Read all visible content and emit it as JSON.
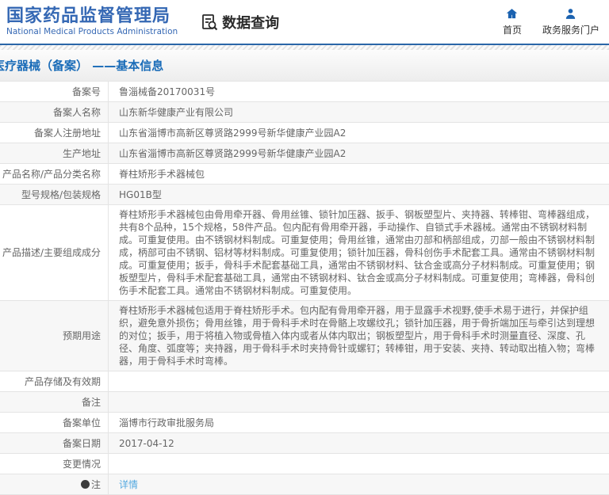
{
  "header": {
    "logo_title": "国家药品监督管理局",
    "logo_subtitle": "National Medical Products Administration",
    "section_title": "数据查询",
    "nav": [
      {
        "label": "首页",
        "icon": "home-icon"
      },
      {
        "label": "政务服务门户",
        "icon": "user-icon"
      }
    ]
  },
  "page": {
    "title": "医疗器械（备案） ——基本信息"
  },
  "table": {
    "rows": [
      {
        "key": "record-number",
        "label": "备案号",
        "value": "鲁淄械备20170031号"
      },
      {
        "key": "filer-name",
        "label": "备案人名称",
        "value": "山东新华健康产业有限公司"
      },
      {
        "key": "filer-registered-address",
        "label": "备案人注册地址",
        "value": "山东省淄博市高新区尊贤路2999号新华健康产业园A2"
      },
      {
        "key": "production-address",
        "label": "生产地址",
        "value": "山东省淄博市高新区尊贤路2999号新华健康产业园A2"
      },
      {
        "key": "product-name",
        "label": "产品名称/产品分类名称",
        "value": "脊柱矫形手术器械包"
      },
      {
        "key": "model-spec",
        "label": "型号规格/包装规格",
        "value": "HG01B型"
      },
      {
        "key": "product-description",
        "label": "产品描述/主要组成成分",
        "value": "脊柱矫形手术器械包由骨用牵开器、骨用丝锥、锁针加压器、扳手、钢板塑型片、夹持器、转棒钳、弯棒器组成，共有8个品种，15个规格，58件产品。包内配有骨用牵开器，手动操作、自锁式手术器械。通常由不锈钢材料制成。可重复使用。由不锈钢材料制成。可重复使用；骨用丝锥，通常由刃部和柄部组成，刃部一般由不锈钢材料制成，柄部可由不锈钢、铝材等材料制成。可重复使用；锁针加压器，骨科创伤手术配套工具。通常由不锈钢材料制成。可重复使用；扳手，骨科手术配套基础工具，通常由不锈钢材料、钛合金或高分子材料制成。可重复使用；钢板塑型片，骨科手术配套基础工具，通常由不锈钢材料、钛合金或高分子材料制成。可重复使用；弯棒器，骨科创伤手术配套工具。通常由不锈钢材料制成。可重复使用。"
      },
      {
        "key": "intended-use",
        "label": "预期用途",
        "value": "脊柱矫形手术器械包适用于脊柱矫形手术。包内配有骨用牵开器，用于显露手术视野,使手术易于进行，并保护组织，避免意外损伤；骨用丝锥，用于骨科手术时在骨骼上攻螺纹孔；锁针加压器，用于骨折端加压与牵引达到理想的对位；扳手，用于将植入物或骨植入体内或者从体内取出；钢板塑型片，用于骨科手术时测量直径、深度、孔径、角度、弧度等；夹持器，用于骨科手术时夹持骨针或螺钉；转棒钳，用于安装、夹持、转动取出植入物；弯棒器，用于骨科手术时弯棒。"
      },
      {
        "key": "storage-validity",
        "label": "产品存储及有效期",
        "value": ""
      },
      {
        "key": "remarks",
        "label": "备注",
        "value": ""
      },
      {
        "key": "filing-authority",
        "label": "备案单位",
        "value": "淄博市行政审批服务局"
      },
      {
        "key": "filing-date",
        "label": "备案日期",
        "value": "2017-04-12"
      },
      {
        "key": "change-status",
        "label": "变更情况",
        "value": ""
      },
      {
        "key": "note",
        "label": "注",
        "label_icon": "note-icon",
        "value": "详情",
        "value_link": true
      }
    ]
  },
  "colors": {
    "accent_blue": "#3568b4",
    "title_blue": "#1a6cb8",
    "link_blue": "#54a9e0",
    "header_border_blue": "#2b66a8",
    "row_stripe": "#f7f7f7",
    "table_border": "#e4e4e4",
    "text_gray": "#666666"
  }
}
